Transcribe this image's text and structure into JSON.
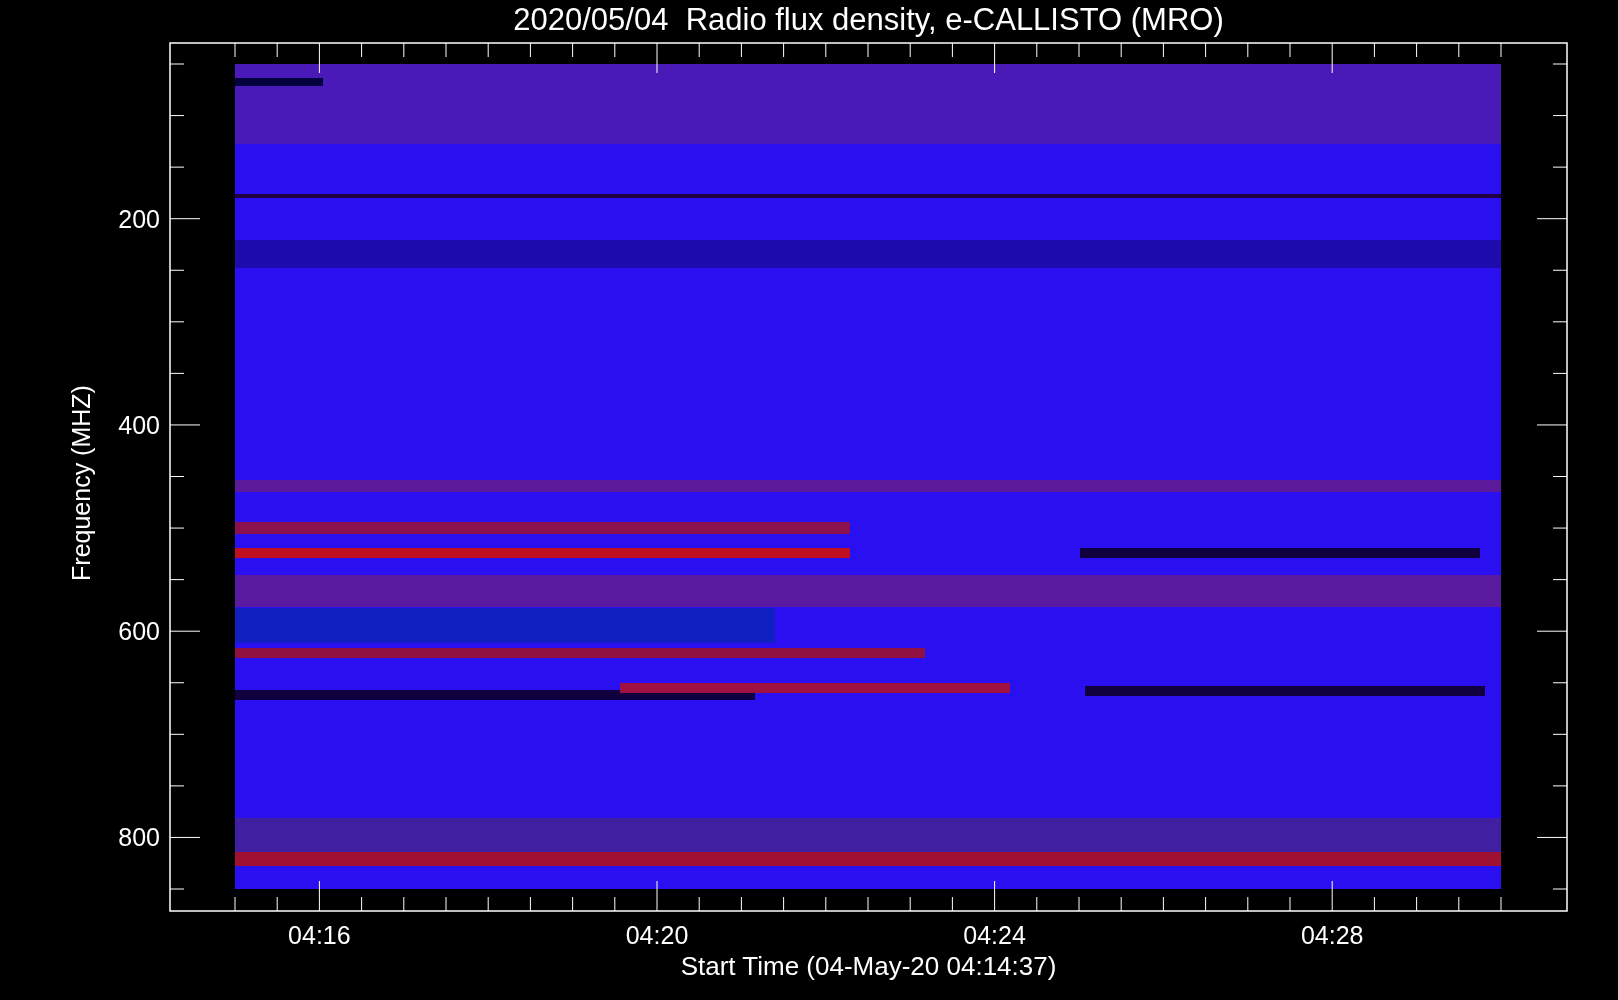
{
  "title": "2020/05/04  Radio flux density, e-CALLISTO (MRO)",
  "y_axis": {
    "label": "Frequency (MHZ)",
    "ticks": [
      "200",
      "400",
      "600",
      "800"
    ]
  },
  "x_axis": {
    "label": "Start Time (04-May-20 04:14:37)",
    "ticks": [
      "04:16",
      "04:20",
      "04:24",
      "04:28"
    ]
  }
}
